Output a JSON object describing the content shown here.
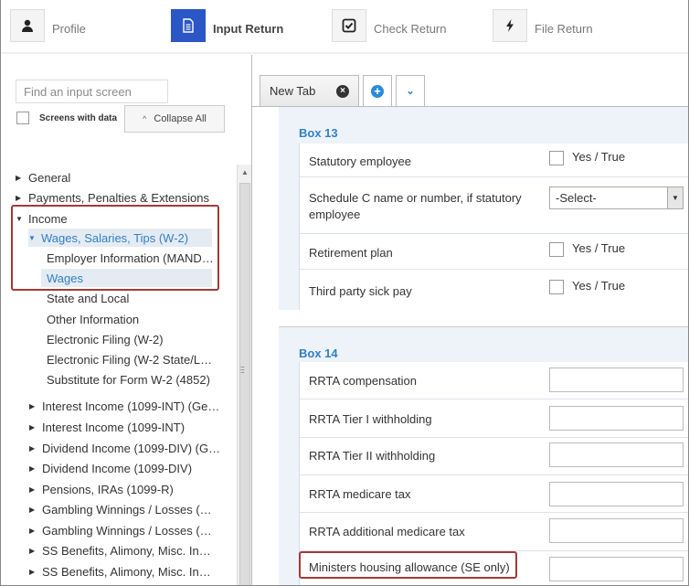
{
  "steps": [
    {
      "label": "Profile",
      "icon": "person-icon"
    },
    {
      "label": "Input Return",
      "icon": "document-icon"
    },
    {
      "label": "Check Return",
      "icon": "checkbox-icon"
    },
    {
      "label": "File Return",
      "icon": "lightning-icon"
    }
  ],
  "sidebar": {
    "search_placeholder": "Find an input screen",
    "screens_with_data": "Screens with data",
    "collapse_all": "Collapse All",
    "tree": [
      "General",
      "Payments, Penalties & Extensions",
      "Income",
      "Wages, Salaries, Tips (W-2)",
      "Employer Information (MAND…",
      "Wages",
      "State and Local",
      "Other Information",
      "Electronic Filing (W-2)",
      "Electronic Filing (W-2 State/L…",
      "Substitute for Form W-2 (4852)",
      "Interest Income (1099-INT) (Ge…",
      "Interest Income (1099-INT)",
      "Dividend Income (1099-DIV) (G…",
      "Dividend Income (1099-DIV)",
      "Pensions, IRAs (1099-R)",
      "Gambling Winnings / Losses (…",
      "Gambling Winnings / Losses (…",
      "SS Benefits, Alimony, Misc. In…",
      "SS Benefits, Alimony, Misc. In…"
    ]
  },
  "tabs": {
    "main": "New Tab"
  },
  "box13": {
    "title": "Box 13",
    "statutory": "Statutory employee",
    "schedule_c": "Schedule C name or number, if statutory employee",
    "select_value": "-Select-",
    "retirement": "Retirement plan",
    "third_party": "Third party sick pay",
    "yes_true": "Yes / True"
  },
  "box14": {
    "title": "Box 14",
    "rows": [
      "RRTA compensation",
      "RRTA Tier I withholding",
      "RRTA Tier II withholding",
      "RRTA medicare tax",
      "RRTA additional medicare tax",
      "Ministers housing allowance (SE only)"
    ]
  }
}
